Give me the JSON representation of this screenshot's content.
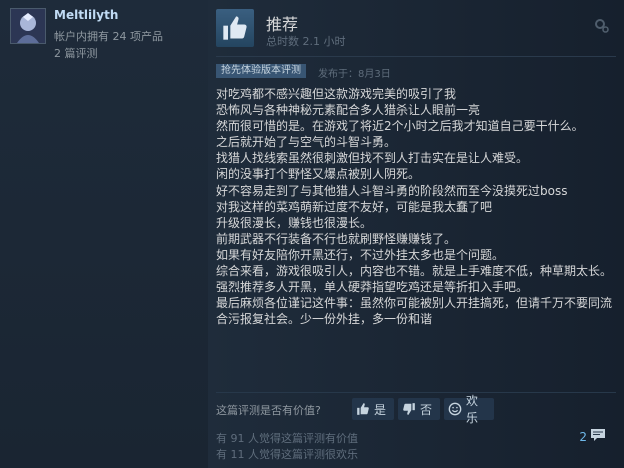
{
  "user": {
    "name": "Meltlilyth",
    "products_owned": "帐户内拥有 24 项产品",
    "reviews_count": "2 篇评测"
  },
  "review": {
    "verdict": "推荐",
    "hours": "总时数 2.1 小时",
    "early_access_tag": "抢先体验版本评测",
    "posted": "发布于：8月3日",
    "body": "对吃鸡都不感兴趣但这款游戏完美的吸引了我\n恐怖风与各种神秘元素配合多人猎杀让人眼前一亮\n然而很可惜的是。在游戏了将近2个小时之后我才知道自己要干什么。\n之后就开始了与空气的斗智斗勇。\n找猎人找线索虽然很刺激但找不到人打击实在是让人难受。\n闲的没事打个野怪又爆点被别人阴死。\n好不容易走到了与其他猎人斗智斗勇的阶段然而至今没摸死过boss\n对我这样的菜鸡萌新过度不友好，可能是我太蠢了吧\n升级很漫长，赚钱也很漫长。\n前期武器不行装备不行也就刷野怪赚赚钱了。\n如果有好友陪你开黑还行，不过外挂太多也是个问题。\n综合来看，游戏很吸引人，内容也不错。就是上手难度不低，种草期太长。\n强烈推荐多人开黑，单人硬莽指望吃鸡还是等折扣入手吧。\n最后麻烦各位谨记这件事：虽然你可能被别人开挂搞死，但请千万不要同流合污报复社会。少一份外挂，多一份和谐"
  },
  "voting": {
    "question": "这篇评测是否有价值?",
    "yes": "是",
    "no": "否",
    "funny": "欢乐"
  },
  "stats": {
    "helpful": "有 91 人觉得这篇评测有价值",
    "funny": "有 11 人觉得这篇评测很欢乐"
  },
  "comments": {
    "count": "2"
  },
  "icons": {
    "verdict": "thumbs-up-icon",
    "settings": "gear-icon",
    "yes": "thumbs-up-icon",
    "no": "thumbs-down-icon",
    "funny": "smiley-icon",
    "comments": "comment-icon"
  },
  "colors": {
    "background": "#1b2838",
    "accent": "#66c0f4",
    "username": "#c1dbf4"
  }
}
